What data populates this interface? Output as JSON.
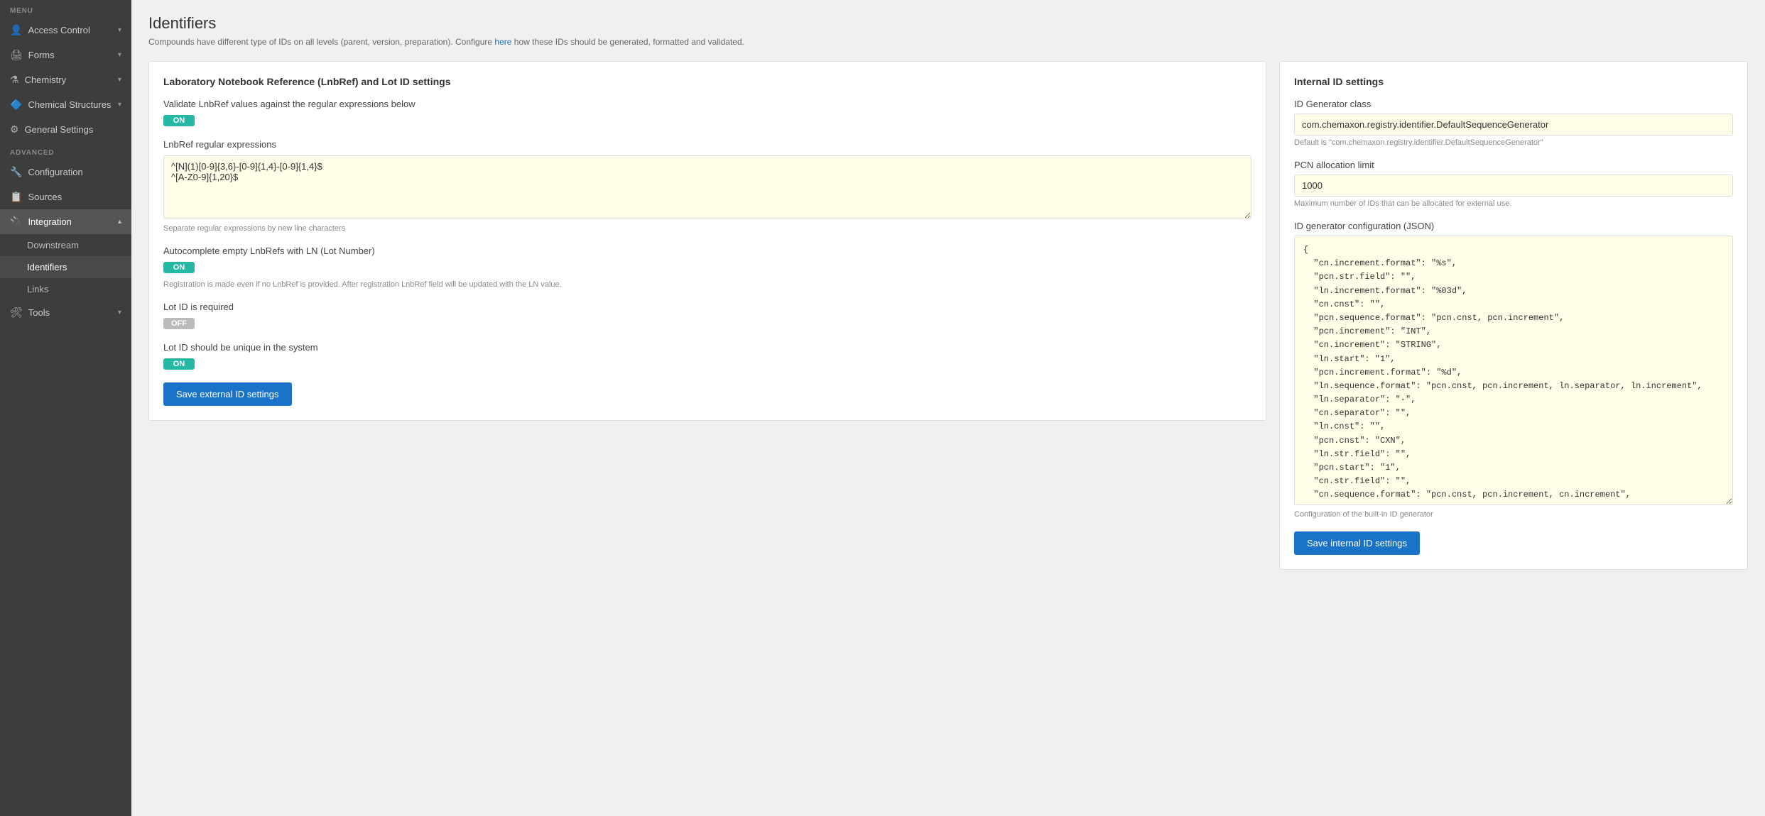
{
  "sidebar": {
    "menu_label": "MENU",
    "advanced_label": "ADVANCED",
    "items": [
      {
        "id": "access-control",
        "label": "Access Control",
        "icon": "👤",
        "hasChevron": true,
        "active": false
      },
      {
        "id": "forms",
        "label": "Forms",
        "icon": "🖨",
        "hasChevron": true,
        "active": false
      },
      {
        "id": "chemistry",
        "label": "Chemistry",
        "icon": "⚗",
        "hasChevron": true,
        "active": false
      },
      {
        "id": "chemical-structures",
        "label": "Chemical Structures",
        "icon": "🔷",
        "hasChevron": true,
        "active": false
      },
      {
        "id": "general-settings",
        "label": "General Settings",
        "icon": "⚙",
        "hasChevron": false,
        "active": false
      }
    ],
    "advanced_items": [
      {
        "id": "configuration",
        "label": "Configuration",
        "icon": "🔧",
        "active": false
      },
      {
        "id": "sources",
        "label": "Sources",
        "icon": "📋",
        "active": false
      },
      {
        "id": "integration",
        "label": "Integration",
        "icon": "🔌",
        "hasChevron": true,
        "active": true
      }
    ],
    "integration_sub": [
      {
        "id": "downstream",
        "label": "Downstream",
        "active": false
      },
      {
        "id": "identifiers",
        "label": "Identifiers",
        "active": true
      },
      {
        "id": "links",
        "label": "Links",
        "active": false
      }
    ],
    "tools_item": {
      "id": "tools",
      "label": "Tools",
      "icon": "🛠",
      "hasChevron": true,
      "active": false
    }
  },
  "page": {
    "title": "Identifiers",
    "subtitle": "Compounds have different type of IDs on all levels (parent, version, preparation). Configure",
    "subtitle_link": "here",
    "subtitle_rest": " how these IDs should be generated, formatted and validated."
  },
  "left_panel": {
    "title": "Laboratory Notebook Reference (LnbRef) and Lot ID settings",
    "validate_label": "Validate LnbRef values against the regular expressions below",
    "validate_toggle": "ON",
    "regex_label": "LnbRef regular expressions",
    "regex_value": "^[N](1)[0-9]{3,6}-[0-9]{1,4}-[0-9]{1,4}$\n^[A-Z0-9]{1,20}$",
    "regex_helper": "Separate regular expressions by new line characters",
    "autocomplete_label": "Autocomplete empty LnbRefs with LN (Lot Number)",
    "autocomplete_toggle": "ON",
    "autocomplete_helper": "Registration is made even if no LnbRef is provided. After registration LnbRef field will be updated with the LN value.",
    "lot_required_label": "Lot ID is required",
    "lot_required_toggle": "OFF",
    "lot_unique_label": "Lot ID should be unique in the system",
    "lot_unique_toggle": "ON",
    "save_button": "Save external ID settings"
  },
  "right_panel": {
    "title": "Internal ID settings",
    "id_generator_label": "ID Generator class",
    "id_generator_value": "com.chemaxon.registry.identifier.DefaultSequenceGenerator",
    "id_generator_helper": "Default is \"com.chemaxon.registry.identifier.DefaultSequenceGenerator\"",
    "pcn_label": "PCN allocation limit",
    "pcn_value": "1000",
    "pcn_helper": "Maximum number of IDs that can be allocated for external use.",
    "json_label": "ID generator configuration (JSON)",
    "json_value": "{\n  \"cn.increment.format\": \"%s\",\n  \"pcn.str.field\": \"\",\n  \"ln.increment.format\": \"%03d\",\n  \"cn.cnst\": \"\",\n  \"pcn.sequence.format\": \"pcn.cnst, pcn.increment\",\n  \"pcn.increment\": \"INT\",\n  \"cn.increment\": \"STRING\",\n  \"ln.start\": \"1\",\n  \"pcn.increment.format\": \"%d\",\n  \"ln.sequence.format\": \"pcn.cnst, pcn.increment, ln.separator, ln.increment\",\n  \"ln.separator\": \"-\",\n  \"cn.separator\": \"\",\n  \"ln.cnst\": \"\",\n  \"pcn.cnst\": \"CXN\",\n  \"ln.str.field\": \"\",\n  \"pcn.start\": \"1\",\n  \"cn.str.field\": \"\",\n  \"cn.sequence.format\": \"pcn.cnst, pcn.increment, cn.increment\",\n  \"ln.increment\": \"INT\",\n  \"cn.start\": \"A\",\n  \"pcn.separator\": \"\"\n}",
    "json_helper": "Configuration of the built-in ID generator",
    "save_button": "Save internal ID settings"
  }
}
